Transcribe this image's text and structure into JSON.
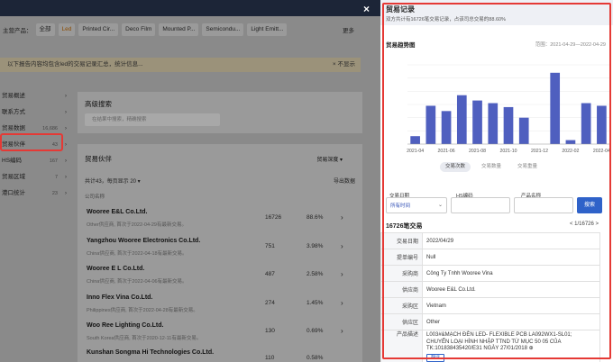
{
  "background": {
    "products_label": "主营产品：",
    "products": [
      {
        "label": "全部",
        "selected": false
      },
      {
        "label": "Led",
        "selected": true
      },
      {
        "label": "Printed Cir...",
        "selected": false
      },
      {
        "label": "Deco Film",
        "selected": false
      },
      {
        "label": "Mounted P...",
        "selected": false
      },
      {
        "label": "Semicondu...",
        "selected": false
      },
      {
        "label": "Light Emitt...",
        "selected": false
      }
    ],
    "more": "更多",
    "notice": "以下报告内容均包含led的交易记录汇总，统计信息...",
    "notice_close": "× 不显示",
    "sidebar": [
      {
        "label": "贸易概述",
        "count": ""
      },
      {
        "label": "联系方式",
        "count": ""
      },
      {
        "label": "贸易数据",
        "count": "16,686"
      },
      {
        "label": "贸易伙伴",
        "count": "43"
      },
      {
        "label": "HS编码",
        "count": "167"
      },
      {
        "label": "贸易区域",
        "count": "7"
      },
      {
        "label": "港口统计",
        "count": "23"
      }
    ],
    "search_card": {
      "title": "高级搜索",
      "placeholder": "在结果中搜索，精确搜索"
    },
    "partners_card": {
      "title": "贸易伙伴",
      "sort": "贸易深度 ▾",
      "subtitle": "共计43，每页显示 20 ▾",
      "export": "导出数据",
      "header": "公司名称"
    },
    "rows": [
      {
        "name": "Wooree E&L Co.Ltd.",
        "desc": "Other供应商, 首次于2022-04-29有最新交易。",
        "trades": "16726",
        "pct": "88.6%"
      },
      {
        "name": "Yangzhou Wooree Electronics Co.Ltd.",
        "desc": "China供应商, 首次于2022-04-18有最新交易。",
        "trades": "751",
        "pct": "3.98%"
      },
      {
        "name": "Wooree E L Co.Ltd.",
        "desc": "China供应商, 首次于2022-04-06有最新交易。",
        "trades": "487",
        "pct": "2.58%"
      },
      {
        "name": "Inno Flex Vina Co.Ltd.",
        "desc": "Philippines供应商, 首次于2022-04-28有最新交易。",
        "trades": "274",
        "pct": "1.45%"
      },
      {
        "name": "Woo Ree Lighting Co.Ltd.",
        "desc": "South Korea供应商, 首次于2020-12-11有最新交易。",
        "trades": "130",
        "pct": "0.69%"
      },
      {
        "name": "Kunshan Songma Hi Technologies Co.Ltd.",
        "desc": "",
        "trades": "110",
        "pct": "0.58%"
      }
    ]
  },
  "panel": {
    "title": "贸易记录",
    "subtitle": "双方共计有16726笔交易记录，占该司总交易的88.60%",
    "trend_title": "贸易趋势图",
    "range": "范围：2021-04-29—2022-04-29",
    "tabs": [
      {
        "label": "交易次数",
        "active": true
      },
      {
        "label": "交易数量",
        "active": false
      },
      {
        "label": "交易重量",
        "active": false
      }
    ],
    "filters": {
      "date_label": "交易日期",
      "date_value": "所有时间",
      "hs_label": "HS编码",
      "product_label": "产品名称",
      "search_button": "搜索"
    },
    "count_label": "16726笔交易",
    "pager": "<   1/16726   >",
    "detail": [
      {
        "k": "交易日期",
        "v": "2022/04/29"
      },
      {
        "k": "提单编号",
        "v": "Null"
      },
      {
        "k": "采购商",
        "v": "Công Ty Tnhh Wooree Vina"
      },
      {
        "k": "供应商",
        "v": "Wooree E&L Co.Ltd."
      },
      {
        "k": "采购区",
        "v": "Vietnam"
      },
      {
        "k": "供应区",
        "v": "Other"
      },
      {
        "k": "产品描述",
        "v": "L003#&MẠCH ĐÈN LED- FLEXIBLE PCB LA092WX1-SL01; CHUYỂN LOẠI HÌNH NHẬP TTND TỪ MỤC 50 05 CỦA TK:101838435420/E31 NGÀY 27/01/2018 ⊕"
      }
    ],
    "translate": "翻译"
  },
  "chart_data": {
    "type": "bar",
    "title": "贸易趋势图",
    "color": "#4f5fbf",
    "x": [
      "2021-04",
      "2021-05",
      "2021-06",
      "2021-07",
      "2021-08",
      "2021-09",
      "2021-10",
      "2021-11",
      "2021-12",
      "2022-01",
      "2022-02",
      "2022-03",
      "2022-04"
    ],
    "xticks": [
      "2021-04",
      "2021-06",
      "2021-08",
      "2021-10",
      "2021-12",
      "2022-02",
      "2022-04"
    ],
    "values": [
      60,
      290,
      250,
      370,
      330,
      310,
      280,
      200,
      0,
      540,
      30,
      310,
      290
    ],
    "ylim": [
      0,
      600
    ],
    "grid": true
  }
}
